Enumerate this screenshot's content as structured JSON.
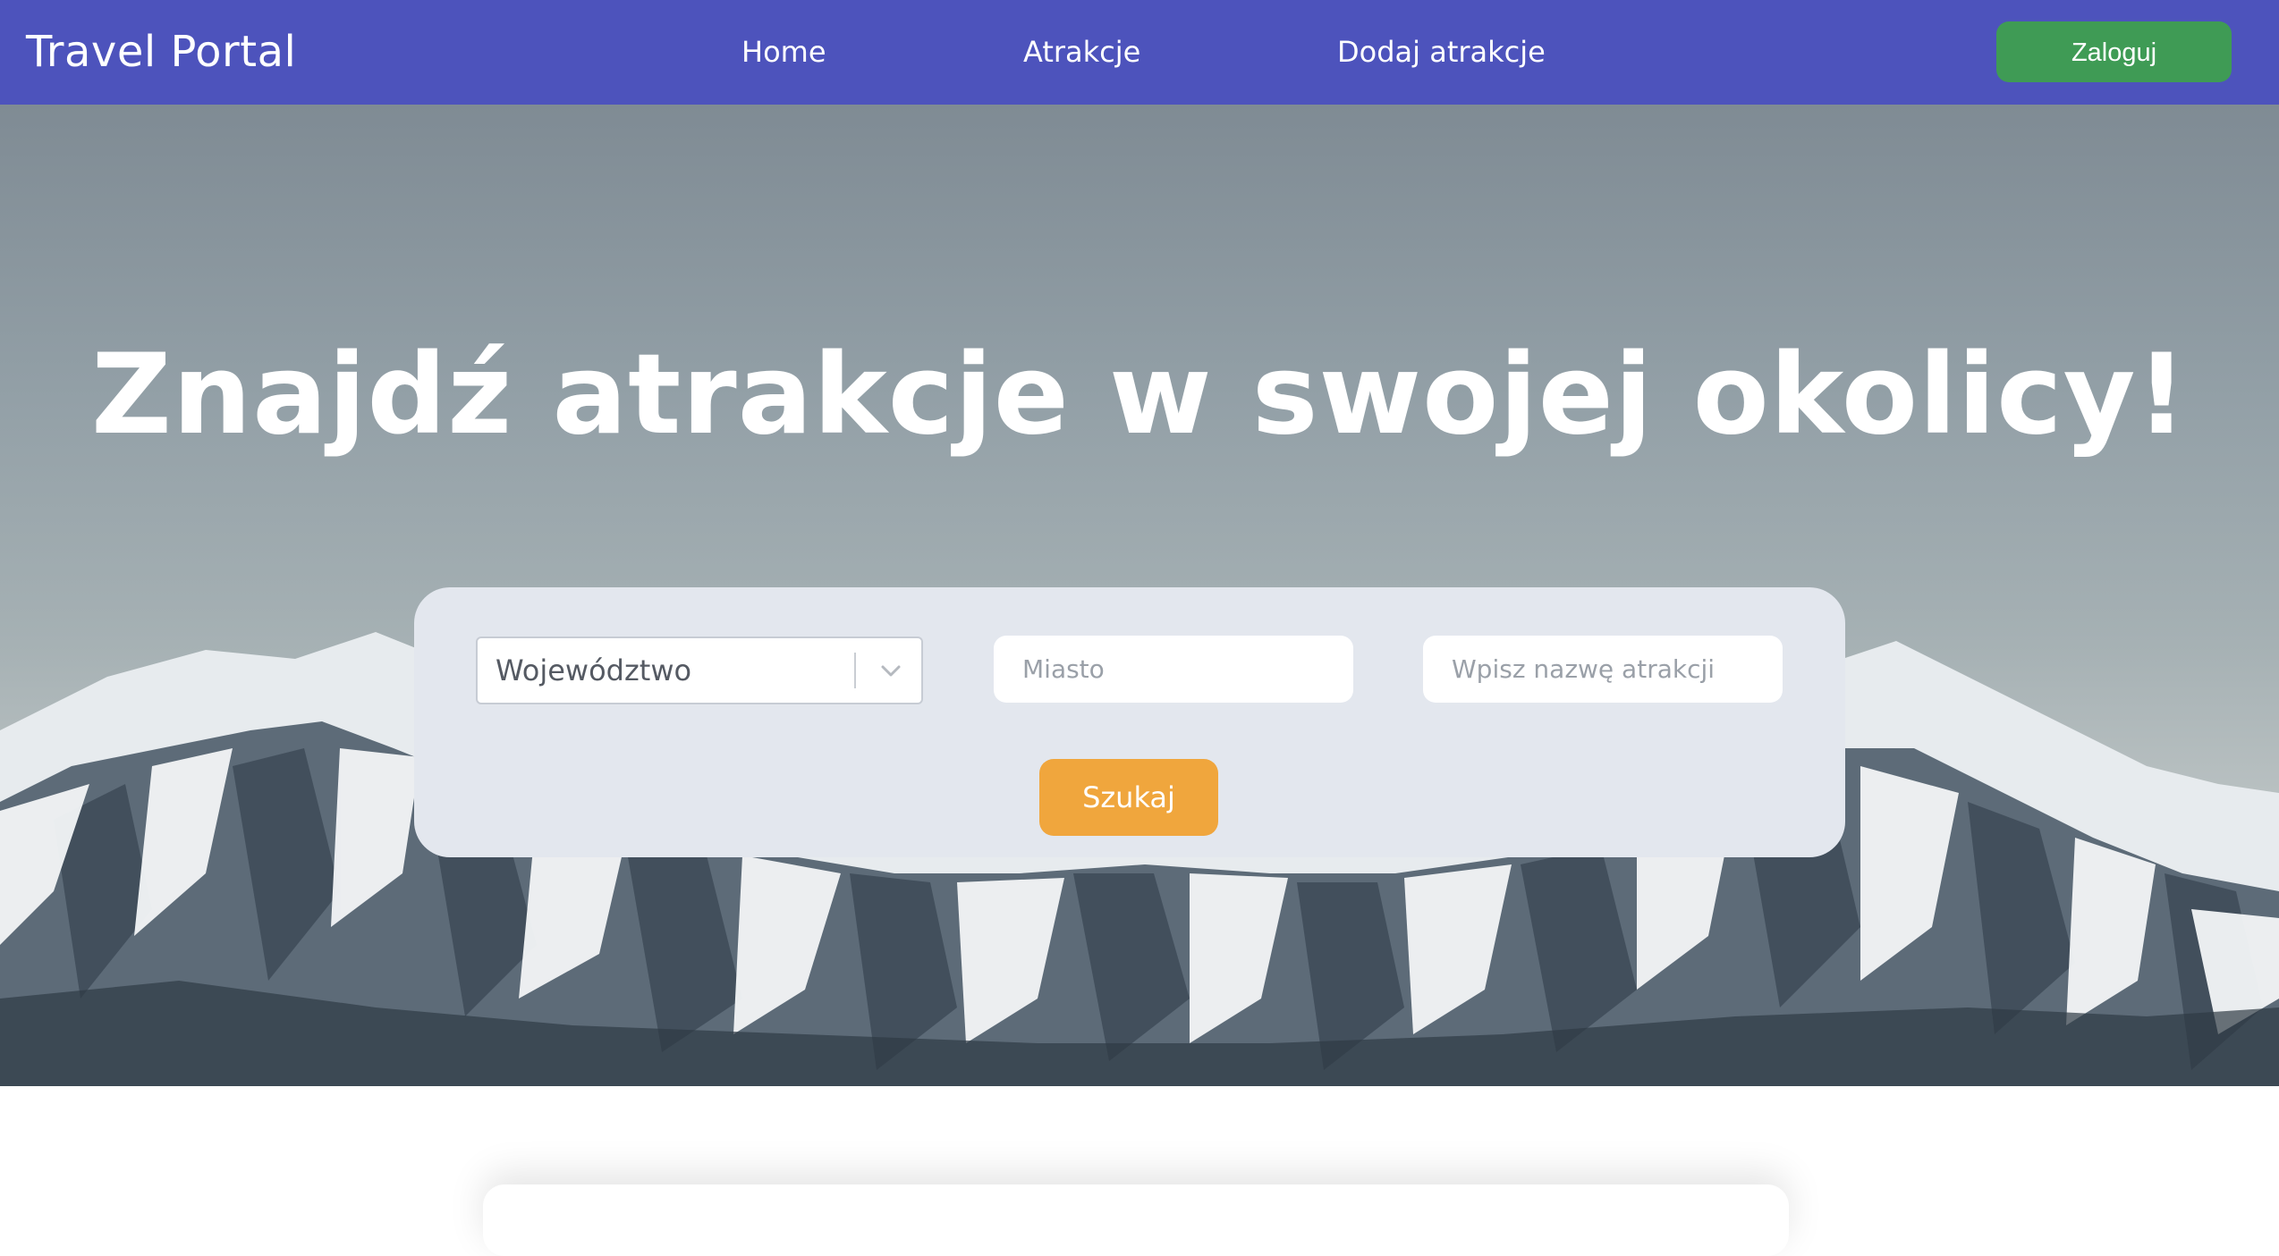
{
  "navbar": {
    "brand": "Travel Portal",
    "links": [
      {
        "label": "Home"
      },
      {
        "label": "Atrakcje"
      },
      {
        "label": "Dodaj atrakcje"
      }
    ],
    "login_label": "Zaloguj"
  },
  "hero": {
    "title": "Znajdź atrakcje w swojej okolicy!"
  },
  "search": {
    "region_select_value": "Województwo",
    "city_placeholder": "Miasto",
    "name_placeholder": "Wpisz nazwę atrakcji",
    "search_label": "Szukaj"
  },
  "icons": {
    "select_arrow": "chevron-down-icon"
  },
  "colors": {
    "navbar": "#4d53bc",
    "login_button": "#3f9b55",
    "search_button": "#f0a63d",
    "panel": "#e3e7ee"
  }
}
